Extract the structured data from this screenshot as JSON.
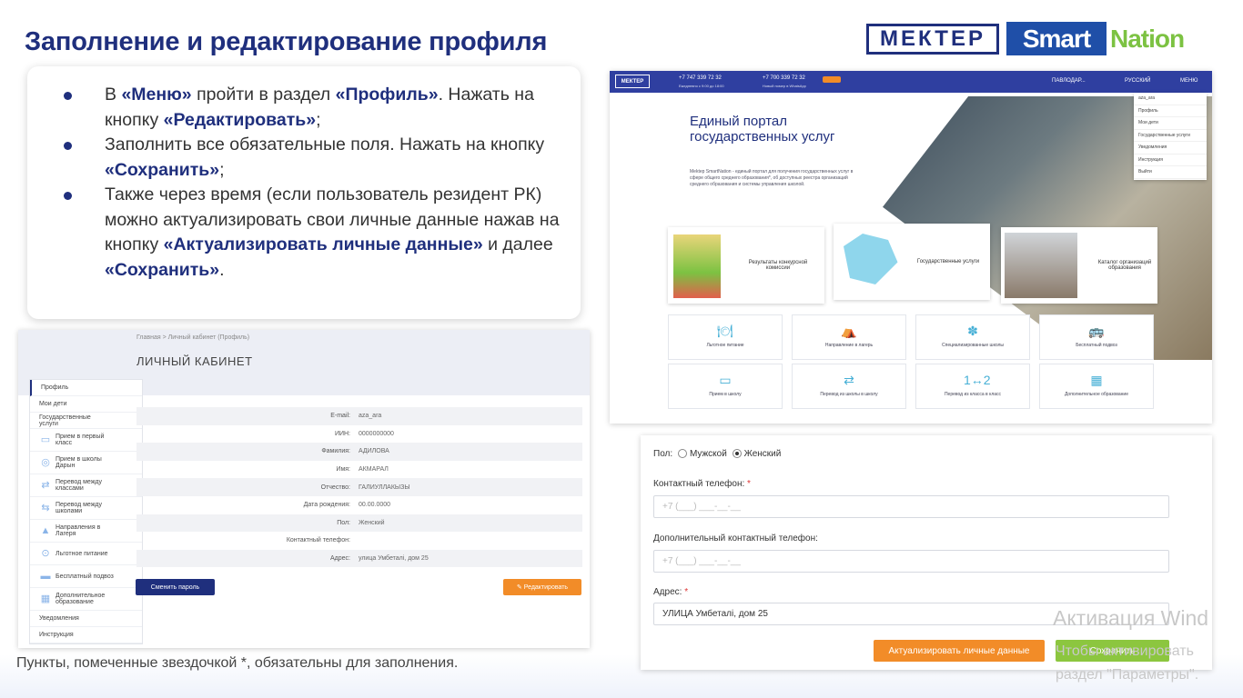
{
  "slide": {
    "title": "Заполнение и редактирование профиля",
    "logo_mektep": "МЕКТЕР",
    "logo_smart": "Smart",
    "logo_nation": "Nation"
  },
  "instructions": {
    "b1_t1": "В ",
    "b1_b1": "«Меню»",
    "b1_t2": " пройти в раздел ",
    "b1_b2": "«Профиль»",
    "b1_t3": ". Нажать на кнопку ",
    "b1_b3": "«Редактировать»",
    "b1_t4": ";",
    "b2_t1": "Заполнить все обязательные поля. Нажать на кнопку ",
    "b2_b1": "«Сохранить»",
    "b2_t2": ";",
    "b3_t1": "Также через время (если пользователь резидент РК) можно актуализировать свои личные данные нажав на кнопку ",
    "b3_b1": "«Актуализировать личные данные»",
    "b3_t2": " и далее ",
    "b3_b2": "«Сохранить»",
    "b3_t3": "."
  },
  "cabinet": {
    "breadcrumb": "Главная  >  Личный кабинет (Профиль)",
    "title": "ЛИЧНЫЙ КАБИНЕТ",
    "sidebar": [
      {
        "label": "Профиль",
        "icon": ""
      },
      {
        "label": "Мои дети",
        "icon": ""
      },
      {
        "label": "Государственные услуги",
        "icon": ""
      },
      {
        "label": "Прием в первый класс",
        "icon": "▭"
      },
      {
        "label": "Прием в школы Дарын",
        "icon": "◎"
      },
      {
        "label": "Перевод между классами",
        "icon": "⇄"
      },
      {
        "label": "Перевод между школами",
        "icon": "⇆"
      },
      {
        "label": "Направления в Лагеря",
        "icon": "▲"
      },
      {
        "label": "Льготное питание",
        "icon": "⊙"
      },
      {
        "label": "Бесплатный подвоз",
        "icon": "▬"
      },
      {
        "label": "Дополнительное образование",
        "icon": "▦"
      },
      {
        "label": "Уведомления",
        "icon": ""
      },
      {
        "label": "Инструкция",
        "icon": ""
      }
    ],
    "fields": [
      {
        "label": "E-mail:",
        "value": "aza_ara"
      },
      {
        "label": "ИИН:",
        "value": "0000000000"
      },
      {
        "label": "Фамилия:",
        "value": "АДИЛОВА"
      },
      {
        "label": "Имя:",
        "value": "АКМАРАЛ"
      },
      {
        "label": "Отчество:",
        "value": "ГАЛИУЛЛАКЫЗЫ"
      },
      {
        "label": "Дата рождения:",
        "value": "00.00.0000"
      },
      {
        "label": "Пол:",
        "value": "Женский"
      },
      {
        "label": "Контактный телефон:",
        "value": ""
      },
      {
        "label": "Адрес:",
        "value": "улица Умбеталі, дом 25"
      }
    ],
    "change_password": "Сменить пароль",
    "edit": "✎  Редактировать"
  },
  "note": "Пункты, помеченные звездочкой *, обязательны для заполнения.",
  "portal": {
    "logo": "МЕКТЕР",
    "phone1": "+7 747 339 72 32",
    "phone1_sub": "Ежедневно с 9:00 до 18:00",
    "phone2": "+7 700 339 72 32",
    "phone2_sub": "Новый номер  в WhatsApp",
    "city": "ПАВЛОДАР...",
    "lang": "РУССКИЙ",
    "menu": "МЕНЮ",
    "menu_items": [
      "aza_ara",
      "Профиль",
      "Мои дети",
      "Государственные услуги",
      "Уведомления",
      "Инструкция",
      "Выйти"
    ],
    "hero_title": "Единый портал государственных услуг",
    "hero_text": "Mektep SmartNation - единый портал для получения государственных услуг в сфере общего среднего образования*, об доступных реестра организаций среднего образования и системы управления школой.",
    "tile1": "Результаты конкурсной комиссии",
    "tile2": "Государственные услуги",
    "tile3": "Каталог организаций образования",
    "services": [
      {
        "label": "Льготное питание",
        "icon": "🍽"
      },
      {
        "label": "Направление в лагерь",
        "icon": "⛺"
      },
      {
        "label": "Специализированные школы",
        "icon": "✽"
      },
      {
        "label": "Бесплатный подвоз",
        "icon": "🚌"
      },
      {
        "label": "Прием в школу",
        "icon": "▭"
      },
      {
        "label": "Перевод из школы в школу",
        "icon": "⇄"
      },
      {
        "label": "Перевод из класса в класс",
        "icon": "1↔2"
      },
      {
        "label": "Дополнительное образование",
        "icon": "▦"
      }
    ]
  },
  "form": {
    "gender_label": "Пол:",
    "male": "Мужской",
    "female": "Женский",
    "phone_label": "Контактный телефон:",
    "phone_placeholder": "+7 (___) ___-__-__",
    "phone2_label": "Дополнительный контактный телефон:",
    "phone2_placeholder": "+7 (___) ___-__-__",
    "address_label": "Адрес:",
    "address_value": "УЛИЦА Умбеталі, дом 25",
    "required_mark": "*",
    "actualize": "Актуализировать личные данные",
    "save": "Сохранить"
  },
  "watermark": {
    "line1": "Активация Wind",
    "line2": "Чтобы активировать",
    "line3": "раздел \"Параметры\"."
  }
}
